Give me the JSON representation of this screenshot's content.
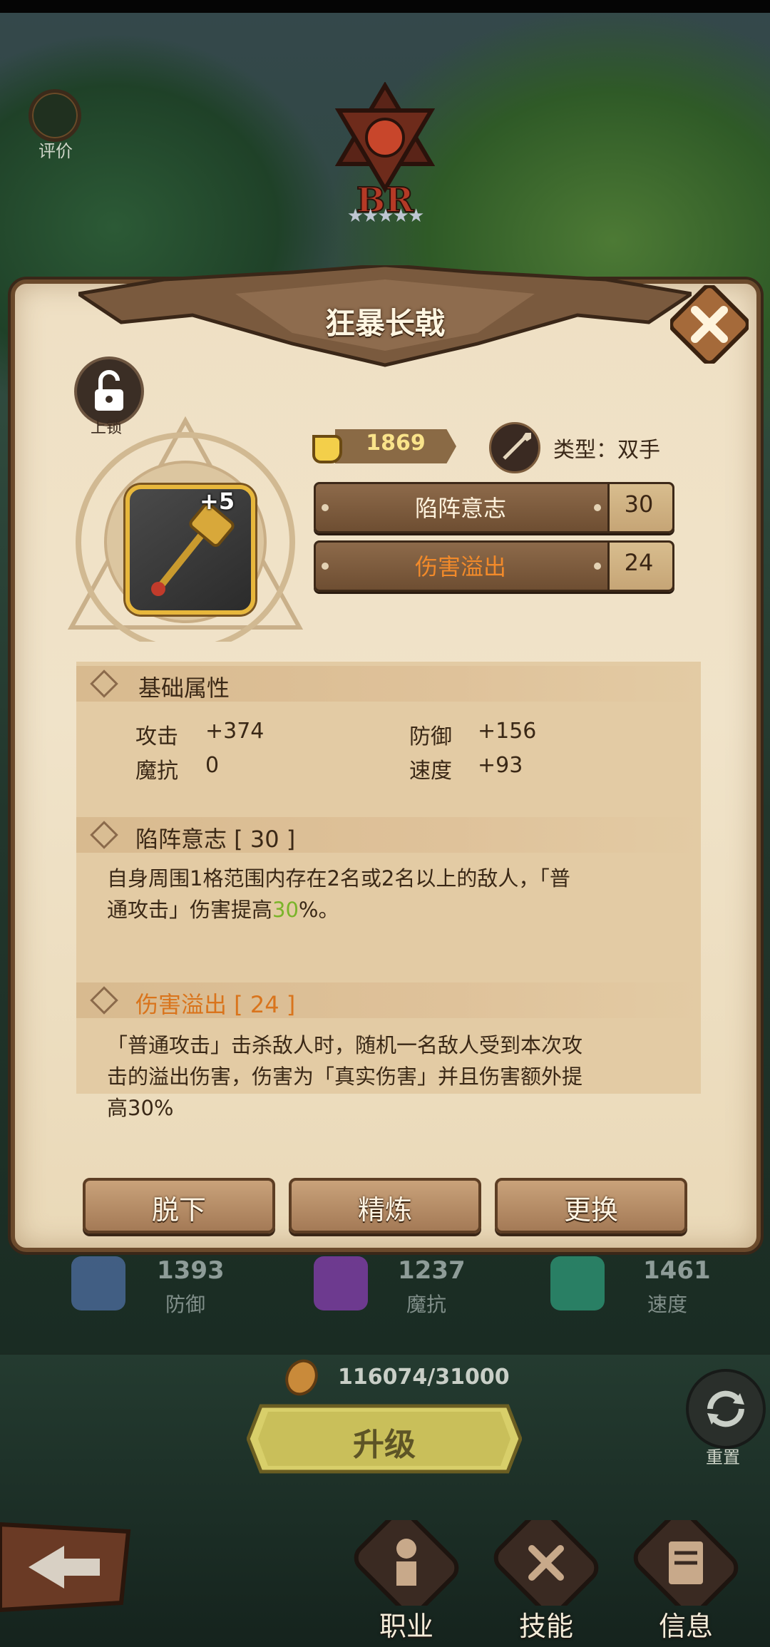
{
  "header": {
    "rating_label": "评价",
    "rank_text": "BR",
    "stars": "★★★★★"
  },
  "item": {
    "name": "狂暴长戟",
    "lock_label": "上锁",
    "plus_level": "+5",
    "power": "1869",
    "type_text": "类型：双手",
    "skills": [
      {
        "name": "陷阵意志",
        "value": "30",
        "color": "#fff3dd"
      },
      {
        "name": "伤害溢出",
        "value": "24",
        "color": "#f28a2a"
      }
    ]
  },
  "info": {
    "base_title": "基础属性",
    "stats": [
      {
        "label": "攻击",
        "value": "+374"
      },
      {
        "label": "防御",
        "value": "+156"
      },
      {
        "label": "魔抗",
        "value": "0"
      },
      {
        "label": "速度",
        "value": "+93"
      }
    ],
    "skill1_title": "陷阵意志 [ 30 ]",
    "skill1_desc_a": "自身周围1格范围内存在2名或2名以上的敌人，「普",
    "skill1_desc_b": "通攻击」伤害提高",
    "skill1_desc_hl": "30",
    "skill1_desc_c": "%。",
    "skill2_title": "伤害溢出 [ 24 ]",
    "skill2_desc_a": "「普通攻击」击杀敌人时，随机一名敌人受到本次攻",
    "skill2_desc_b": "击的溢出伤害，伤害为「真实伤害」并且伤害额外提",
    "skill2_desc_c": "高30%"
  },
  "actions": {
    "unequip": "脱下",
    "refine": "精炼",
    "replace": "更换"
  },
  "bottom_stats": [
    {
      "value": "1393",
      "label": "防御",
      "color": "#4f6fa3"
    },
    {
      "value": "1237",
      "label": "魔抗",
      "color": "#8a3fb3"
    },
    {
      "value": "1461",
      "label": "速度",
      "color": "#2f9b7a"
    }
  ],
  "upgrade": {
    "gold_text": "116074/31000",
    "button_label": "升级",
    "reset_label": "重置"
  },
  "nav": [
    {
      "label": "职业",
      "icon": "pawn-icon"
    },
    {
      "label": "技能",
      "icon": "skill-icon"
    },
    {
      "label": "信息",
      "icon": "document-icon"
    }
  ],
  "colors": {
    "accent_gold": "#e7b73c",
    "panel_bg": "#efe0c4",
    "highlight_green": "#7ab42a",
    "skill_orange": "#d9741c"
  }
}
